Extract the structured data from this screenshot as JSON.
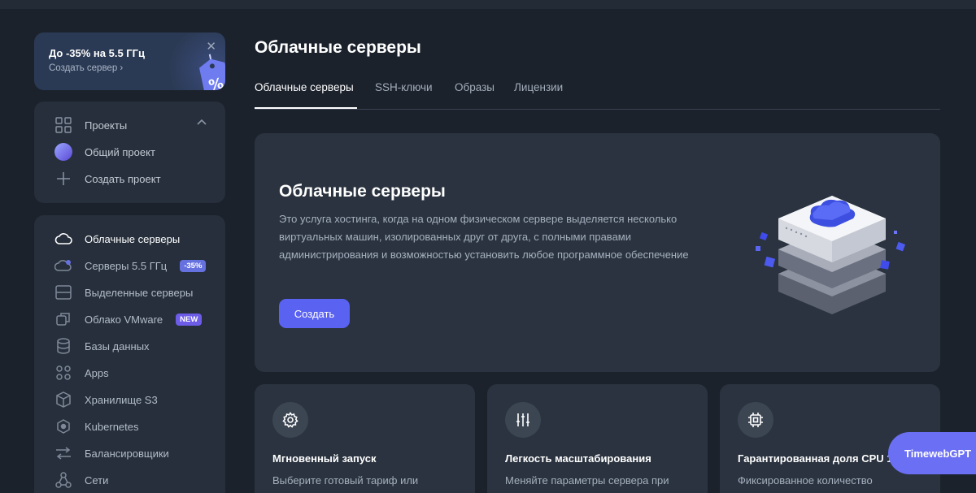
{
  "promo": {
    "title": "До -35% на 5.5 ГГц",
    "subtitle": "Создать сервер ›",
    "close": "✕",
    "tag_symbol": "%"
  },
  "projects": {
    "header": "Проекты",
    "items": [
      {
        "label": "Общий проект",
        "icon": "project-avatar-icon"
      },
      {
        "label": "Создать проект",
        "icon": "plus-icon"
      }
    ]
  },
  "sidebar": {
    "items": [
      {
        "label": "Облачные серверы",
        "icon": "cloud-icon",
        "active": true
      },
      {
        "label": "Серверы 5.5 ГГц",
        "icon": "fast-cloud-icon",
        "badge": "-35%"
      },
      {
        "label": "Выделенные серверы",
        "icon": "dedicated-server-icon"
      },
      {
        "label": "Облако VMware",
        "icon": "vmware-icon",
        "badge": "NEW"
      },
      {
        "label": "Базы данных",
        "icon": "database-icon"
      },
      {
        "label": "Apps",
        "icon": "apps-icon"
      },
      {
        "label": "Хранилище S3",
        "icon": "storage-cube-icon"
      },
      {
        "label": "Kubernetes",
        "icon": "kubernetes-icon"
      },
      {
        "label": "Балансировщики",
        "icon": "balancer-icon"
      },
      {
        "label": "Сети",
        "icon": "network-icon"
      }
    ]
  },
  "main": {
    "title": "Облачные серверы",
    "tabs": [
      {
        "label": "Облачные серверы",
        "active": true
      },
      {
        "label": "SSH-ключи"
      },
      {
        "label": "Образы"
      },
      {
        "label": "Лицензии"
      }
    ],
    "hero": {
      "title": "Облачные серверы",
      "description": "Это услуга хостинга, когда на одном физическом сервере выделяется несколько виртуальных машин, изолированных друг от друга, с полными правами администрирования и возможностью установить любое программное обеспечение",
      "button": "Создать"
    },
    "features": [
      {
        "title": "Мгновенный запуск",
        "text": "Выберите готовый тариф или",
        "icon": "gear-icon"
      },
      {
        "title": "Легкость масштабирования",
        "text": "Меняйте параметры сервера при",
        "icon": "sliders-icon"
      },
      {
        "title": "Гарантированная доля CPU 10",
        "text": "Фиксированное количество",
        "icon": "cpu-chip-icon"
      }
    ]
  },
  "assistant": {
    "label": "TimewebGPT"
  },
  "colors": {
    "accent": "#5a62f2",
    "background": "#1b222c",
    "panel": "#262f3b",
    "badge": "#6671e0"
  }
}
